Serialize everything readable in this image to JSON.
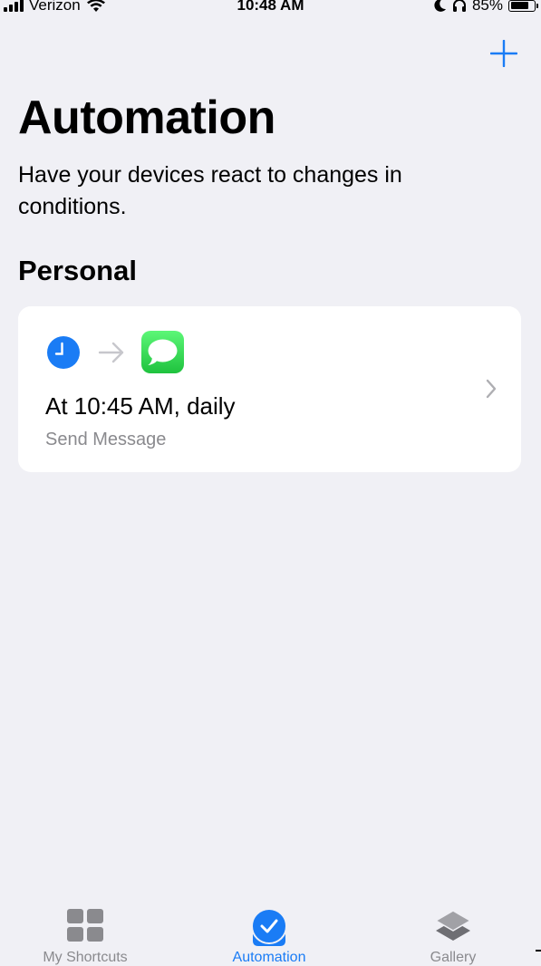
{
  "status_bar": {
    "carrier": "Verizon",
    "time": "10:48 AM",
    "battery": "85%",
    "battery_level": 0.85,
    "icons": [
      "signal-icon",
      "wifi-icon",
      "moon-icon",
      "headphones-icon",
      "battery-icon"
    ]
  },
  "header": {
    "add_icon": "plus-icon",
    "title": "Automation",
    "subtitle": "Have your devices react to changes in conditions."
  },
  "sections": [
    {
      "title": "Personal",
      "items": [
        {
          "trigger_icon": "clock-icon",
          "action_icon": "messages-icon",
          "title": "At 10:45 AM, daily",
          "subtitle": "Send Message"
        }
      ]
    }
  ],
  "tab_bar": {
    "tabs": [
      {
        "label": "My Shortcuts",
        "icon": "grid-icon",
        "active": false
      },
      {
        "label": "Automation",
        "icon": "automation-check-icon",
        "active": true
      },
      {
        "label": "Gallery",
        "icon": "layers-icon",
        "active": false
      }
    ]
  },
  "colors": {
    "accent": "#1a7cf5",
    "background": "#f0f0f5",
    "card": "#ffffff",
    "secondary_text": "#8a8a8e",
    "messages_green": "#34c759"
  }
}
